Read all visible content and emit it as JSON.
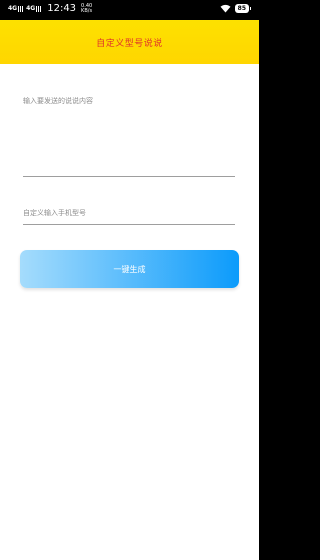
{
  "status_bar": {
    "signal1": "4G",
    "signal2": "4G",
    "time": "12:43",
    "speed_value": "0.40",
    "speed_unit": "KB/s",
    "battery": "85"
  },
  "app_bar": {
    "title": "自定义型号说说"
  },
  "form": {
    "content_placeholder": "输入要发送的说说内容",
    "model_placeholder": "自定义输入手机型号",
    "generate_label": "一键生成"
  },
  "colors": {
    "app_bar": "#ffd600",
    "title": "#e0342a",
    "button_start": "#a5dcfc",
    "button_end": "#0c9bfb"
  },
  "icons": [
    "wifi-icon",
    "battery-icon",
    "signal-icon"
  ]
}
